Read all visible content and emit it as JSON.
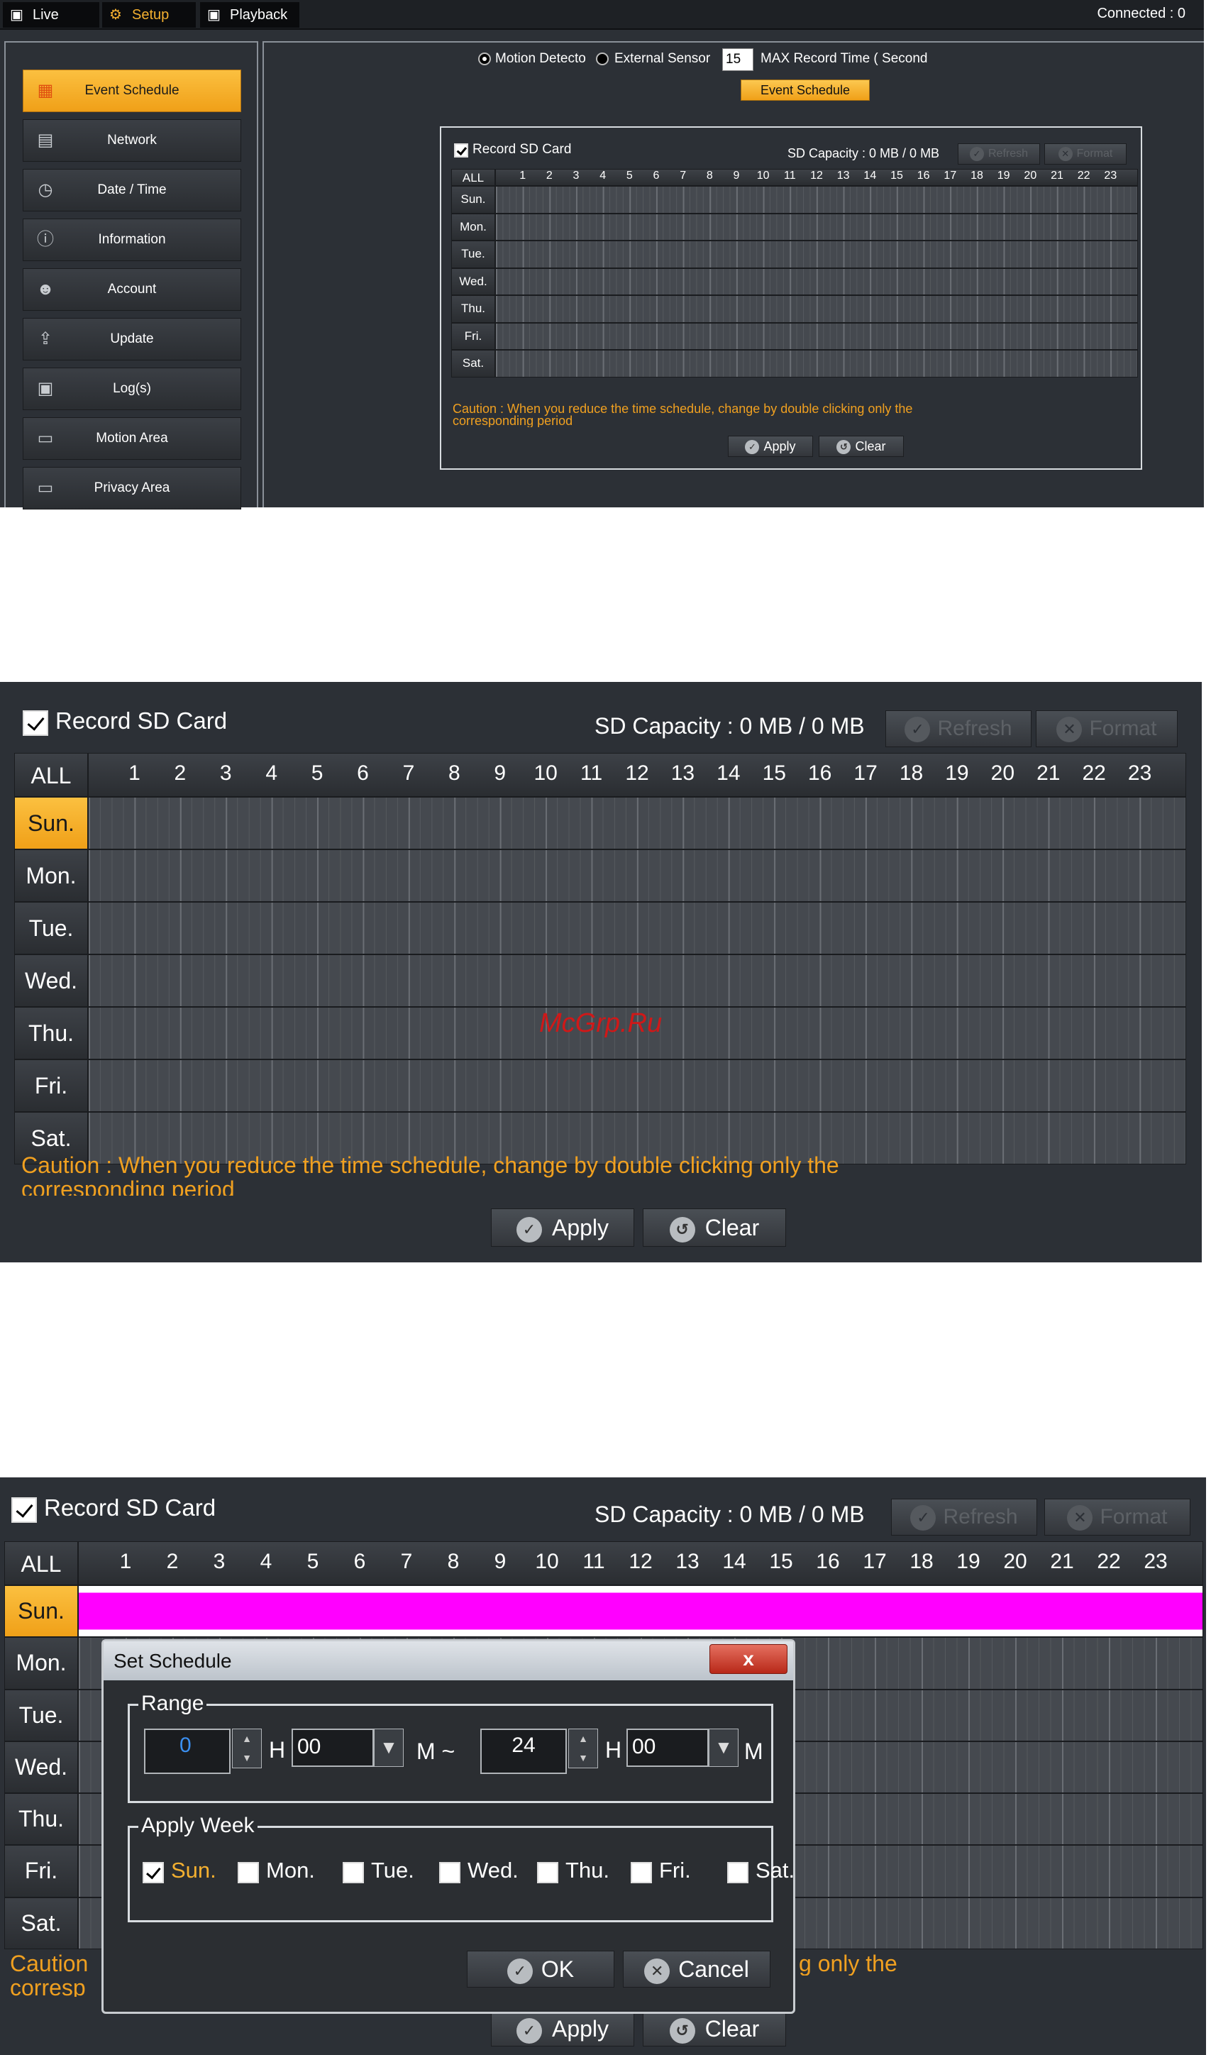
{
  "colors": {
    "accent": "#f4b030",
    "caution": "#f0a020",
    "highlight": "#ff00ff"
  },
  "panel1": {
    "tabs": [
      {
        "label": "Live",
        "icon": "film-icon"
      },
      {
        "label": "Setup",
        "icon": "gears-icon"
      },
      {
        "label": "Playback",
        "icon": "film-icon"
      }
    ],
    "connected": "Connected : 0",
    "menu": [
      {
        "label": "Event Schedule",
        "icon": "schedule-icon",
        "selected": true
      },
      {
        "label": "Network",
        "icon": "network-icon"
      },
      {
        "label": "Date / Time",
        "icon": "clock-icon"
      },
      {
        "label": "Information",
        "icon": "info-icon"
      },
      {
        "label": "Account",
        "icon": "account-icon"
      },
      {
        "label": "Update",
        "icon": "update-icon"
      },
      {
        "label": "Log(s)",
        "icon": "log-icon"
      },
      {
        "label": "Motion Area",
        "icon": "motion-area-icon"
      },
      {
        "label": "Privacy Area",
        "icon": "privacy-area-icon"
      }
    ],
    "motion_detect_label": "Motion Detecto",
    "external_sensor_label": "External Sensor",
    "max_record_value": "15",
    "max_record_label": "MAX Record Time ( Second",
    "event_schedule_button": "Event Schedule"
  },
  "schedule": {
    "record_sd_label": "Record SD Card",
    "sd_capacity": "SD Capacity : 0 MB / 0 MB",
    "refresh_label": "Refresh",
    "format_label": "Format",
    "all_label": "ALL",
    "hours": [
      "1",
      "2",
      "3",
      "4",
      "5",
      "6",
      "7",
      "8",
      "9",
      "10",
      "11",
      "12",
      "13",
      "14",
      "15",
      "16",
      "17",
      "18",
      "19",
      "20",
      "21",
      "22",
      "23"
    ],
    "days": [
      "Sun.",
      "Mon.",
      "Tue.",
      "Wed.",
      "Thu.",
      "Fri.",
      "Sat."
    ],
    "caution": "Caution : When you reduce the time schedule, change by double clicking only the",
    "caution_cut": "corresponding period",
    "apply_label": "Apply",
    "clear_label": "Clear",
    "watermark": "McGrp.Ru"
  },
  "dialog": {
    "title": "Set Schedule",
    "close": "x",
    "range_legend": "Range",
    "start_hour": "0",
    "start_minute": "00",
    "end_hour": "24",
    "end_minute": "00",
    "h": "H",
    "m": "M",
    "tilde": "M ~",
    "week_legend": "Apply Week",
    "week": [
      {
        "label": "Sun.",
        "checked": true
      },
      {
        "label": "Mon.",
        "checked": false
      },
      {
        "label": "Tue.",
        "checked": false
      },
      {
        "label": "Wed.",
        "checked": false
      },
      {
        "label": "Thu.",
        "checked": false
      },
      {
        "label": "Fri.",
        "checked": false
      },
      {
        "label": "Sat.",
        "checked": false
      }
    ],
    "ok": "OK",
    "cancel": "Cancel",
    "caution_left": "Caution",
    "caution_left_cut": "corresp",
    "caution_right": "g only the"
  }
}
